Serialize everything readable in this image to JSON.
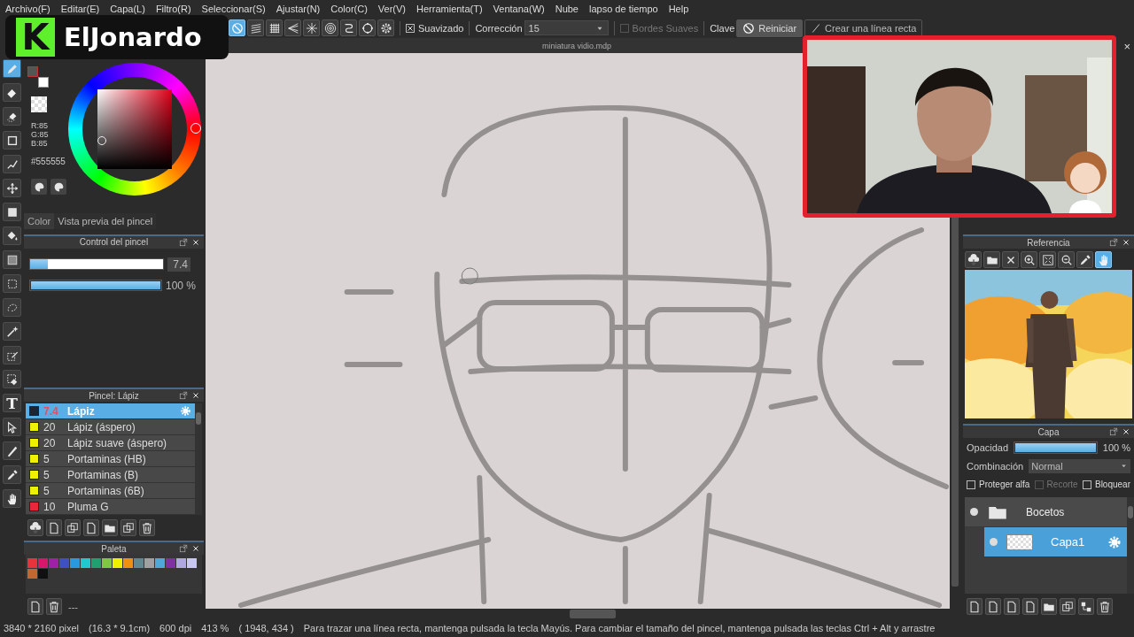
{
  "menu": [
    "Archivo(F)",
    "Editar(E)",
    "Capa(L)",
    "Filtro(R)",
    "Seleccionar(S)",
    "Ajustar(N)",
    "Color(C)",
    "Ver(V)",
    "Herramienta(T)",
    "Ventana(W)",
    "Nube",
    "lapso de tiempo",
    "Help"
  ],
  "toolbar": {
    "rulers": [
      {
        "kind": "none",
        "selected": true
      },
      {
        "kind": "parallel",
        "selected": false
      },
      {
        "kind": "grid",
        "selected": false
      },
      {
        "kind": "perspective",
        "selected": false
      },
      {
        "kind": "radial",
        "selected": false
      },
      {
        "kind": "concentric",
        "selected": false
      },
      {
        "kind": "curve",
        "selected": false
      },
      {
        "kind": "ellipse",
        "selected": false
      },
      {
        "kind": "settings",
        "selected": false
      }
    ],
    "antialias": {
      "label": "Suavizado",
      "checked": true
    },
    "correction": {
      "label": "Corrección",
      "value": "15"
    },
    "soft_edges": {
      "label": "Bordes Suaves",
      "checked": false,
      "disabled": true
    },
    "key_label": "Clave",
    "reset_button": "Reiniciar",
    "line_button": "Crear una línea recta"
  },
  "overlay_logo": {
    "mark": "K",
    "name": "ElJonardo"
  },
  "document": {
    "title": "miniatura vidio.mdp",
    "close": "×"
  },
  "tools": [
    {
      "kind": "pen",
      "selected": true
    },
    {
      "kind": "eraser",
      "selected": false
    },
    {
      "kind": "blur",
      "selected": false
    },
    {
      "kind": "rect",
      "selected": false
    },
    {
      "kind": "dotpen",
      "selected": false
    },
    {
      "kind": "move",
      "selected": false
    },
    {
      "kind": "fill",
      "selected": false
    },
    {
      "kind": "bucket",
      "selected": false
    },
    {
      "kind": "gradient",
      "selected": false
    },
    {
      "kind": "select",
      "selected": false
    },
    {
      "kind": "lasso",
      "selected": false
    },
    {
      "kind": "wand",
      "selected": false
    },
    {
      "kind": "selpen",
      "selected": false
    },
    {
      "kind": "seleraser",
      "selected": false
    },
    {
      "kind": "text",
      "glyph": "T",
      "selected": false
    },
    {
      "kind": "operation",
      "selected": false
    },
    {
      "kind": "cutter",
      "selected": false
    },
    {
      "kind": "dropper",
      "selected": false
    },
    {
      "kind": "hand",
      "selected": false
    }
  ],
  "color_panel": {
    "foreground": {
      "color": "#555555"
    },
    "background": {
      "color": "#ffffff"
    },
    "rgb": [
      "R:85",
      "G:85",
      "B:85"
    ],
    "hex": "#555555",
    "tabs": [
      {
        "label": "Color",
        "selected": true
      },
      {
        "label": "Vista previa del pincel",
        "selected": false
      }
    ]
  },
  "brush_control": {
    "title": "Control del pincel",
    "size": {
      "level": 0.13,
      "value": "7.4"
    },
    "opacity": {
      "level": 1,
      "value": "100 %"
    }
  },
  "brush_panel": {
    "title": "Pincel: Lápiz",
    "brushes": [
      {
        "color": "#1c2533",
        "size": "7.4",
        "name": "Lápiz",
        "selected": true
      },
      {
        "color": "#f0f000",
        "size": "20",
        "name": "Lápiz (áspero)",
        "selected": false
      },
      {
        "color": "#f0f000",
        "size": "20",
        "name": "Lápiz suave (áspero)",
        "selected": false
      },
      {
        "color": "#f0f000",
        "size": "5",
        "name": "Portaminas (HB)",
        "selected": false
      },
      {
        "color": "#f0f000",
        "size": "5",
        "name": "Portaminas (B)",
        "selected": false
      },
      {
        "color": "#f0f000",
        "size": "5",
        "name": "Portaminas (6B)",
        "selected": false
      },
      {
        "color": "#e8283a",
        "size": "10",
        "name": "Pluma G",
        "selected": false
      }
    ]
  },
  "palette": {
    "title": "Paleta",
    "colors": [
      {
        "color": "#e8323c"
      },
      {
        "color": "#d8166e"
      },
      {
        "color": "#a020a8"
      },
      {
        "color": "#4050c0"
      },
      {
        "color": "#2a9ae0"
      },
      {
        "color": "#20c8d0"
      },
      {
        "color": "#20a070"
      },
      {
        "color": "#80c840"
      },
      {
        "color": "#f0f000"
      },
      {
        "color": "#f09010"
      },
      {
        "color": "#608890"
      },
      {
        "color": "#a0a0a0"
      },
      {
        "color": "#50a8d8"
      },
      {
        "color": "#8030a0"
      },
      {
        "color": "#b0a8e0"
      },
      {
        "color": "#c8c8f0"
      },
      {
        "color": "#c06830"
      },
      {
        "color": "#101010"
      }
    ],
    "footer": "---"
  },
  "reference": {
    "title": "Referencia",
    "tools": [
      {
        "kind": "import",
        "selected": false
      },
      {
        "kind": "folder",
        "selected": false
      },
      {
        "kind": "close",
        "selected": false
      },
      {
        "kind": "zoomin",
        "selected": false
      },
      {
        "kind": "fit",
        "selected": false
      },
      {
        "kind": "zoomout",
        "selected": false
      },
      {
        "kind": "dropper",
        "selected": false
      },
      {
        "kind": "hand",
        "selected": true
      }
    ]
  },
  "layers": {
    "title": "Capa",
    "opacity": {
      "label": "Opacidad",
      "level": 1,
      "value": "100 %"
    },
    "blend": {
      "label": "Combinación",
      "value": "Normal"
    },
    "options": [
      {
        "label": "Proteger alfa",
        "checked": false,
        "disabled": false
      },
      {
        "label": "Recorte",
        "checked": false,
        "disabled": true
      },
      {
        "label": "Bloquear",
        "checked": false,
        "disabled": false
      }
    ],
    "items": [
      {
        "kind": "folder",
        "name": "Bocetos",
        "visible": true,
        "selected": false,
        "children": [
          {
            "kind": "layer",
            "name": "Capa1",
            "visible": true,
            "selected": true
          }
        ]
      }
    ]
  },
  "status_bar": {
    "fields": [
      "3840 * 2160 pixel",
      "(16.3 * 9.1cm)",
      "600 dpi",
      "413 %",
      "( 1948, 434 )"
    ],
    "message": "Para trazar una línea recta, mantenga pulsada la tecla Mayús. Para cambiar el tamaño del pincel, mantenga pulsada las teclas Ctrl + Alt y arrastre"
  }
}
